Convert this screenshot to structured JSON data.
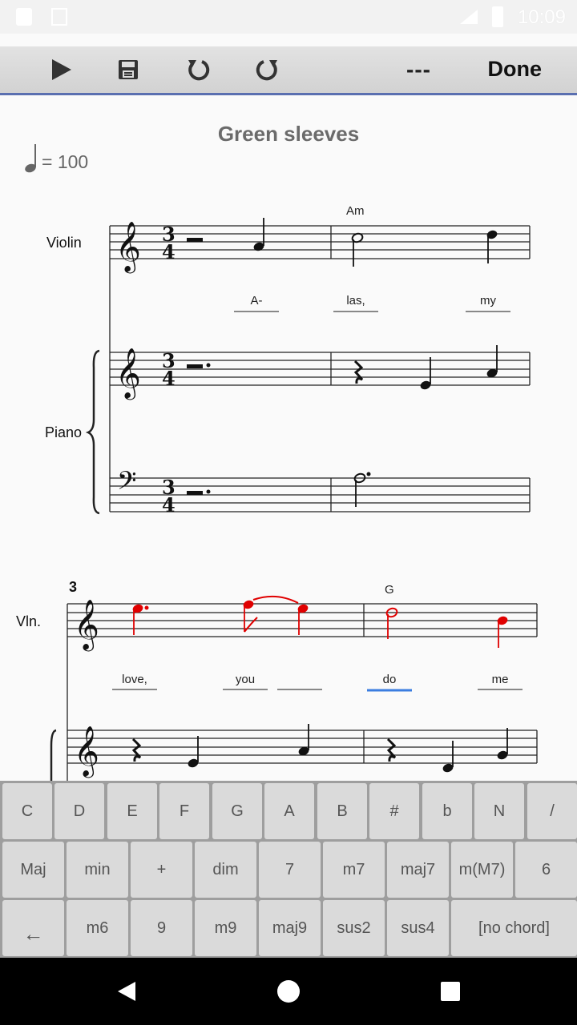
{
  "statusbar": {
    "time": "10:09"
  },
  "toolbar": {
    "dashes_label": "---",
    "done_label": "Done"
  },
  "score": {
    "title": "Green sleeves",
    "tempo_value": "= 100",
    "system1": {
      "instrument_violin": "Violin",
      "instrument_piano": "Piano",
      "chord_am": "Am",
      "lyrics": [
        "A-",
        "las,",
        "my"
      ]
    },
    "system2": {
      "measure_number": "3",
      "instrument_violin_abbr": "Vln.",
      "chord_g": "G",
      "lyrics": [
        "love,",
        "you",
        "do",
        "me"
      ]
    }
  },
  "keyboard": {
    "row1": [
      "C",
      "D",
      "E",
      "F",
      "G",
      "A",
      "B",
      "#",
      "b",
      "N",
      "/"
    ],
    "row2": [
      "Maj",
      "min",
      "+",
      "dim",
      "7",
      "m7",
      "maj7",
      "m(M7)",
      "6"
    ],
    "row3": [
      "←",
      "m6",
      "9",
      "m9",
      "maj9",
      "sus2",
      "sus4",
      "[no chord]"
    ]
  },
  "colors": {
    "selected_note": "#e00000",
    "lyric_cursor": "#3b7de0",
    "toolbar_accent": "#5a6fb0"
  }
}
